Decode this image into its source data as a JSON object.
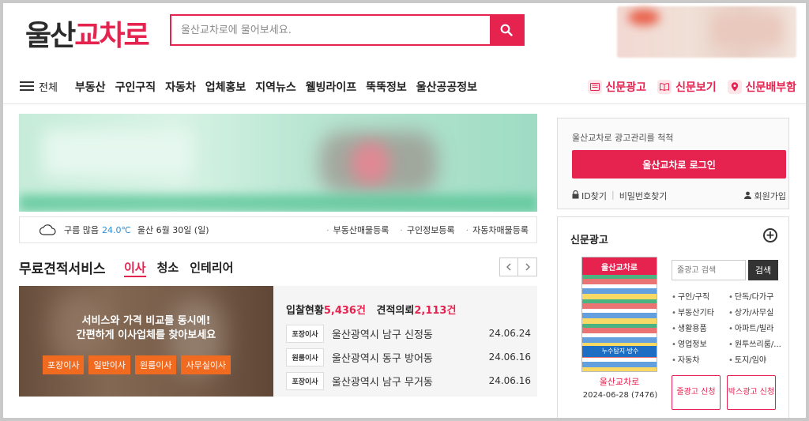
{
  "header": {
    "logo_part1": "울산",
    "logo_part2": "교차로",
    "search_placeholder": "울산교차로에 물어보세요."
  },
  "nav": {
    "all_label": "전체",
    "items": [
      "부동산",
      "구인구직",
      "자동차",
      "업체홍보",
      "지역뉴스",
      "웰빙라이프",
      "뚝뚝정보",
      "울산공공정보"
    ],
    "right": [
      "신문광고",
      "신문보기",
      "신문배부함"
    ]
  },
  "weather": {
    "condition": "구름 많음",
    "temp": "24.0℃",
    "date": "울산 6월 30일 (일)",
    "links": [
      "부동산매물등록",
      "구인정보등록",
      "자동차매물등록"
    ]
  },
  "free_estimate": {
    "title": "무료견적서비스",
    "tabs": [
      "이사",
      "청소",
      "인테리어"
    ],
    "promo_line1": "서비스와 가격 비교를 동시에!",
    "promo_line2": "간편하게 이사업체를 찾아보세요",
    "promo_tags": [
      "포장이사",
      "일반이사",
      "원룸이사",
      "사무실이사"
    ],
    "bid_label": "입찰현황",
    "bid_count": "5,436건",
    "quote_label": "견적의뢰",
    "quote_count": "2,113건",
    "rows": [
      {
        "tag": "포장이사",
        "addr": "울산광역시 남구 신정동",
        "date": "24.06.24"
      },
      {
        "tag": "원룸이사",
        "addr": "울산광역시 동구 방어동",
        "date": "24.06.16"
      },
      {
        "tag": "포장이사",
        "addr": "울산광역시 남구 무거동",
        "date": "24.06.16"
      }
    ]
  },
  "login": {
    "notice": "울산교차로 광고관리를 척척",
    "button": "울산교차로 로그인",
    "find_id": "ID찾기",
    "find_pw": "비밀번호찾기",
    "join": "회원가입"
  },
  "newspaper": {
    "title": "신문광고",
    "cover_title": "울산교차로",
    "cover_footer": "누수탐지·방수",
    "name": "울산교차로",
    "date": "2024-06-28 (7476)",
    "search_placeholder": "줄광고 검색",
    "search_button": "검색",
    "categories": [
      "구인/구직",
      "단독/다가구",
      "부동산기타",
      "상가/사무실",
      "생활용품",
      "아파트/빌라",
      "영업정보",
      "원투쓰리룸/...",
      "자동차",
      "토지/임야"
    ],
    "btn_line": "줄광고 신청",
    "btn_box": "박스광고 신청"
  },
  "colors": {
    "accent": "#e6224f",
    "temp": "#2f8fd8",
    "promo_tag": "#f06a20"
  }
}
